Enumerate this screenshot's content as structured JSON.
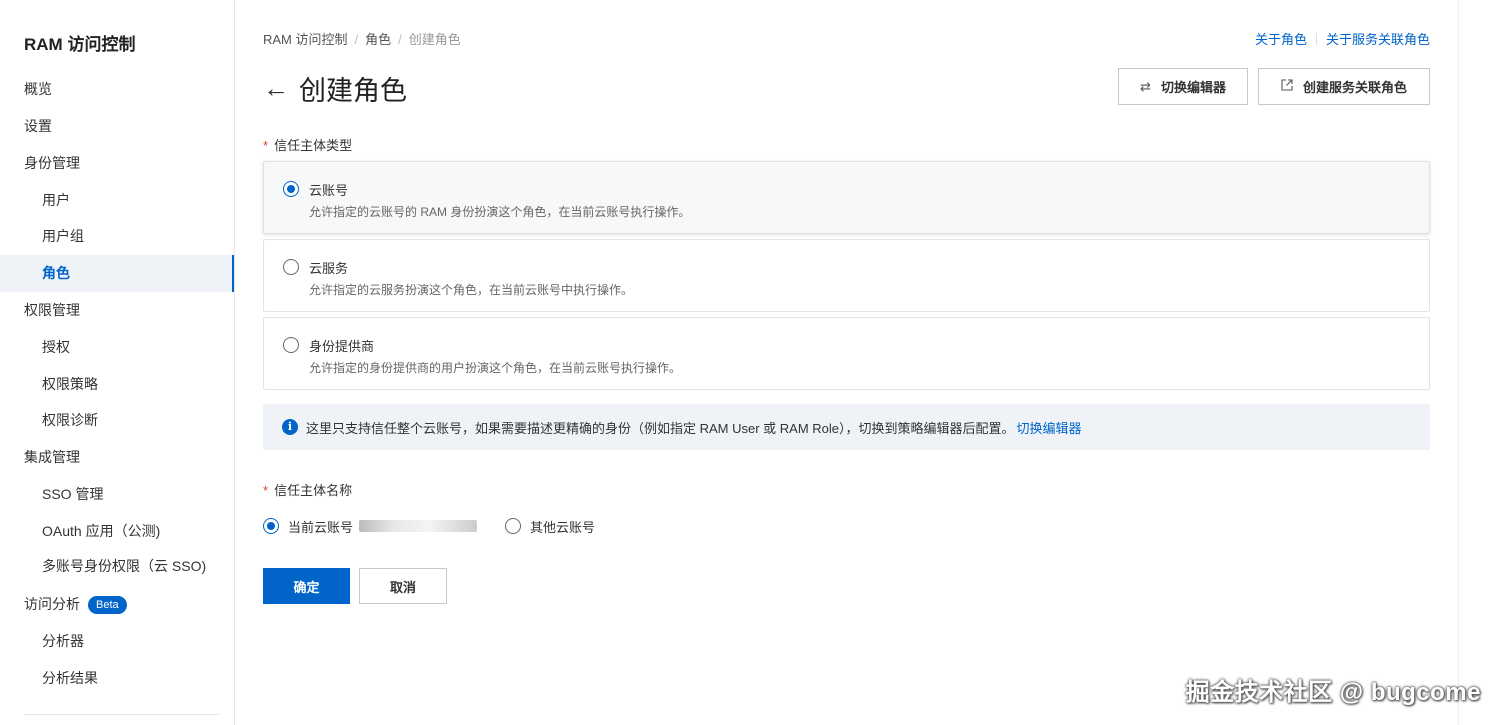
{
  "sidebar": {
    "title": "RAM 访问控制",
    "items": [
      {
        "label": "概览"
      },
      {
        "label": "设置"
      },
      {
        "label": "身份管理"
      },
      {
        "label": "用户"
      },
      {
        "label": "用户组"
      },
      {
        "label": "角色"
      },
      {
        "label": "权限管理"
      },
      {
        "label": "授权"
      },
      {
        "label": "权限策略"
      },
      {
        "label": "权限诊断"
      },
      {
        "label": "集成管理"
      },
      {
        "label": "SSO 管理"
      },
      {
        "label": "OAuth 应用（公测)"
      },
      {
        "label": "多账号身份权限（云 SSO)"
      },
      {
        "label": "访问分析",
        "badge": "Beta"
      },
      {
        "label": "分析器"
      },
      {
        "label": "分析结果"
      }
    ]
  },
  "breadcrumb": [
    "RAM 访问控制",
    "角色",
    "创建角色"
  ],
  "top_links": [
    "关于角色",
    "关于服务关联角色"
  ],
  "page": {
    "title": "创建角色",
    "switch_editor_label": "切换编辑器",
    "create_service_role_label": "创建服务关联角色"
  },
  "form": {
    "principal_type_label": "信任主体类型",
    "options": [
      {
        "title": "云账号",
        "desc": "允许指定的云账号的 RAM 身份扮演这个角色，在当前云账号执行操作。"
      },
      {
        "title": "云服务",
        "desc": "允许指定的云服务扮演这个角色，在当前云账号中执行操作。"
      },
      {
        "title": "身份提供商",
        "desc": "允许指定的身份提供商的用户扮演这个角色，在当前云账号执行操作。"
      }
    ],
    "info_text": "这里只支持信任整个云账号，如果需要描述更精确的身份（例如指定 RAM User 或 RAM Role），切换到策略编辑器后配置。",
    "info_link": "切换编辑器",
    "principal_name_label": "信任主体名称",
    "principal_current": "当前云账号",
    "principal_other": "其他云账号",
    "confirm": "确定",
    "cancel": "取消"
  },
  "watermark": "掘金技术社区 @ bugcome",
  "colors": {
    "accent": "#0064c8",
    "required": "#e03c2d"
  }
}
